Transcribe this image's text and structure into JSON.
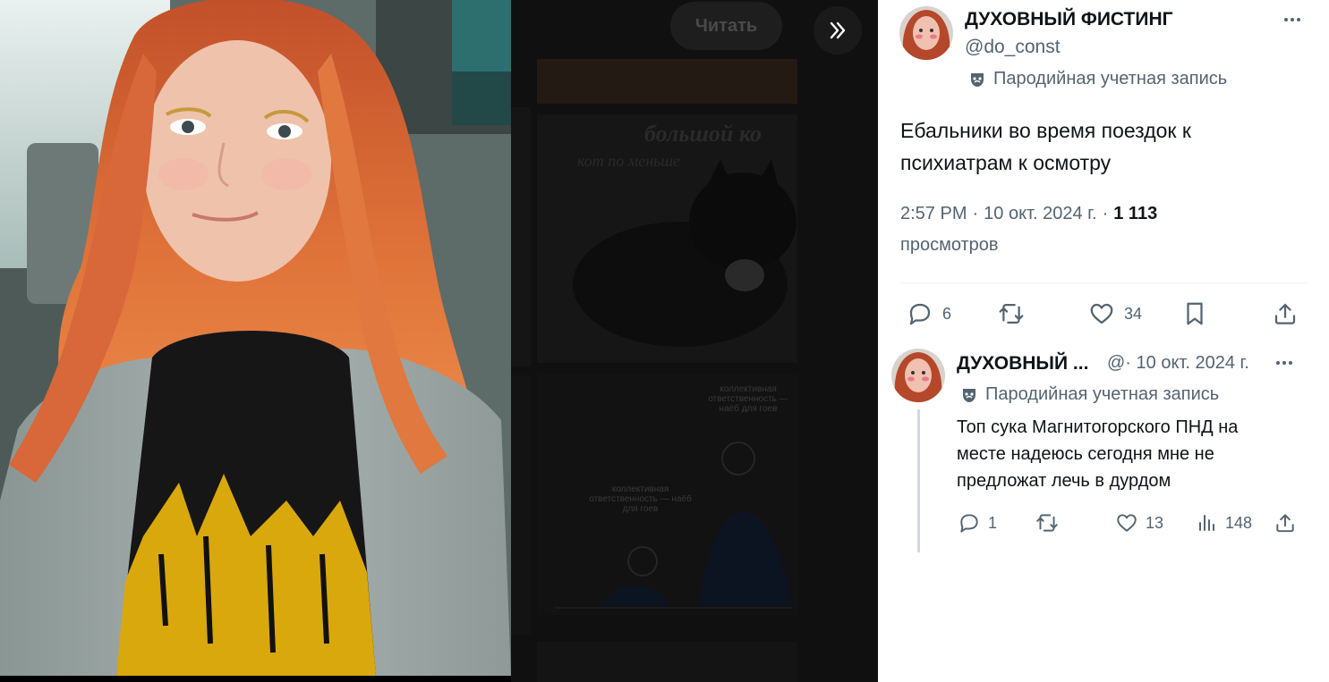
{
  "viewer": {
    "read_button": "Читать"
  },
  "tweet": {
    "author_name": "ДУХОВНЫЙ ФИСТИНГ",
    "handle": "@do_const",
    "parody_label": "Пародийная учетная запись",
    "text_line1": "Ебальники во время поездок к",
    "text_line2": "психиатрам к осмотру",
    "time": "2:57 PM",
    "sep": "·",
    "date": "10 окт. 2024 г.",
    "views_count": "1 113",
    "views_label": "просмотров",
    "replies": "6",
    "likes": "34"
  },
  "reply": {
    "author_name": "ДУХОВНЫЙ ...",
    "handle_date": "@· 10 окт. 2024 г.",
    "parody_label": "Пародийная учетная запись",
    "text_line1": "Топ сука Магнитогорского ПНД на",
    "text_line2": "месте надеюсь сегодня мне не",
    "text_line3": "предложат лечь в дурдом",
    "replies": "1",
    "likes": "13",
    "views": "148"
  },
  "background_meme": {
    "label_top": "коллективная ответственность — наёб для гоев",
    "label_left": "коллективная ответственность — наёб для гоев"
  },
  "icons": [
    "reply-icon",
    "retweet-icon",
    "like-icon",
    "bookmark-icon",
    "share-icon",
    "views-icon",
    "more-icon",
    "expand-icon",
    "mask-icon"
  ],
  "colors": {
    "text": "#0f1419",
    "muted": "#536471",
    "thread_line": "#cfd9de"
  }
}
